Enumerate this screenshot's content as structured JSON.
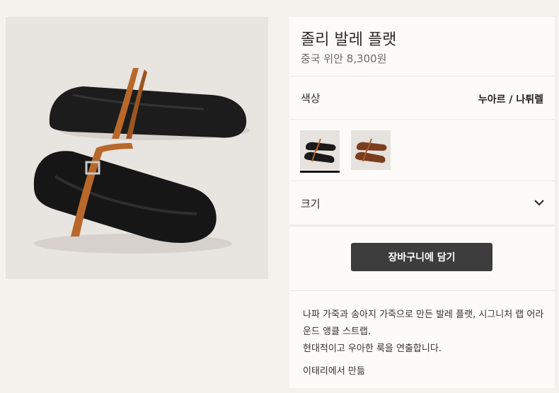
{
  "product": {
    "title": "졸리 발레 플랫",
    "price": "중국 위안 8,300원"
  },
  "options": {
    "color_label": "색상",
    "color_value": "누아르 / 나튀렐",
    "swatches": [
      {
        "name": "black",
        "selected": true
      },
      {
        "name": "brown",
        "selected": false
      }
    ],
    "size_label": "크기"
  },
  "actions": {
    "add_to_cart": "장바구니에 담기"
  },
  "description": {
    "line1": "나파 가죽과 송아지 가죽으로 만든 발레 플랫, 시그니처 랩 어라운드 앵클 스트랩.",
    "line2": "현대적이고 우아한 룩을 연출합니다.",
    "made_in": "이태리에서 만듦"
  },
  "colors": {
    "background": "#f5f2ee",
    "panel": "#fdfbf7",
    "button": "#3d3d3d",
    "leather_black": "#1a1a1a",
    "strap_tan": "#b8682a"
  }
}
